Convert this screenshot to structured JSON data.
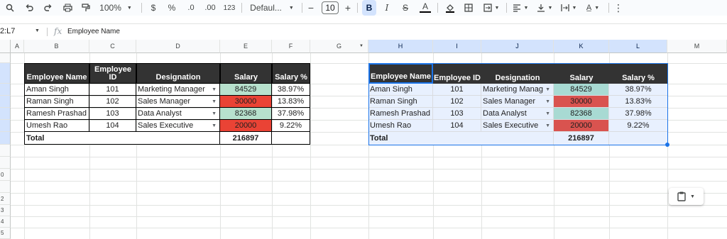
{
  "toolbar": {
    "zoom": "100%",
    "currency": "$",
    "percent": "%",
    "decrease_decimal": ".0",
    "increase_decimal": ".00",
    "number_format": "123",
    "font_family": "Defaul...",
    "font_size": "10",
    "minus": "−",
    "plus": "+",
    "bold": "B",
    "italic": "I",
    "strike": "S",
    "text_color": "A",
    "more": "⋮"
  },
  "formula_bar": {
    "name_box": "2:L7",
    "fx": "fx",
    "content": "Employee Name"
  },
  "columns": [
    "A",
    "B",
    "C",
    "D",
    "E",
    "F",
    "G",
    "H",
    "I",
    "J",
    "K",
    "L",
    "M"
  ],
  "rows": [
    "",
    "",
    "",
    "",
    "",
    "",
    "",
    "",
    "",
    "0",
    "",
    "2",
    "3",
    "4",
    "5"
  ],
  "table1": {
    "headers": [
      "Employee Name",
      "Employee ID",
      "Designation",
      "Salary",
      "Salary %"
    ],
    "rows": [
      {
        "name": "Aman Singh",
        "id": "101",
        "designation": "Marketing Manager",
        "salary": "84529",
        "pct": "38.97%"
      },
      {
        "name": "Raman Singh",
        "id": "102",
        "designation": "Sales Manager",
        "salary": "30000",
        "pct": "13.83%"
      },
      {
        "name": "Ramesh Prashad",
        "id": "103",
        "designation": "Data Analyst",
        "salary": "82368",
        "pct": "37.98%"
      },
      {
        "name": "Umesh Rao",
        "id": "104",
        "designation": "Sales Executive",
        "salary": "20000",
        "pct": "9.22%"
      }
    ],
    "total_label": "Total",
    "total_value": "216897"
  },
  "table2": {
    "headers": [
      "Employee Name",
      "Employee ID",
      "Designation",
      "Salary",
      "Salary %"
    ],
    "rows": [
      {
        "name": "Aman Singh",
        "id": "101",
        "designation": "Marketing Manag",
        "salary": "84529",
        "pct": "38.97%"
      },
      {
        "name": "Raman Singh",
        "id": "102",
        "designation": "Sales Manager",
        "salary": "30000",
        "pct": "13.83%"
      },
      {
        "name": "Ramesh Prashad",
        "id": "103",
        "designation": "Data Analyst",
        "salary": "82368",
        "pct": "37.98%"
      },
      {
        "name": "Umesh Rao",
        "id": "104",
        "designation": "Sales Executive",
        "salary": "20000",
        "pct": "9.22%"
      }
    ],
    "total_label": "Total",
    "total_value": "216897"
  },
  "colors": {
    "header_bg": "#333333",
    "selection": "#1a73e8",
    "high_salary_t1": "#b7e1cd",
    "low_salary_t1": "#ea4335",
    "high_salary_t2": "#a8dad3",
    "low_salary_t2": "#d9534f",
    "selected_range": "#e8f0fe"
  },
  "icons": [
    "search-icon",
    "undo-icon",
    "redo-icon",
    "print-icon",
    "paint-format-icon",
    "fill-color-icon",
    "borders-icon",
    "merge-cells-icon",
    "align-left-icon",
    "valign-bottom-icon",
    "text-wrap-icon",
    "text-rotate-icon",
    "clipboard-icon"
  ]
}
